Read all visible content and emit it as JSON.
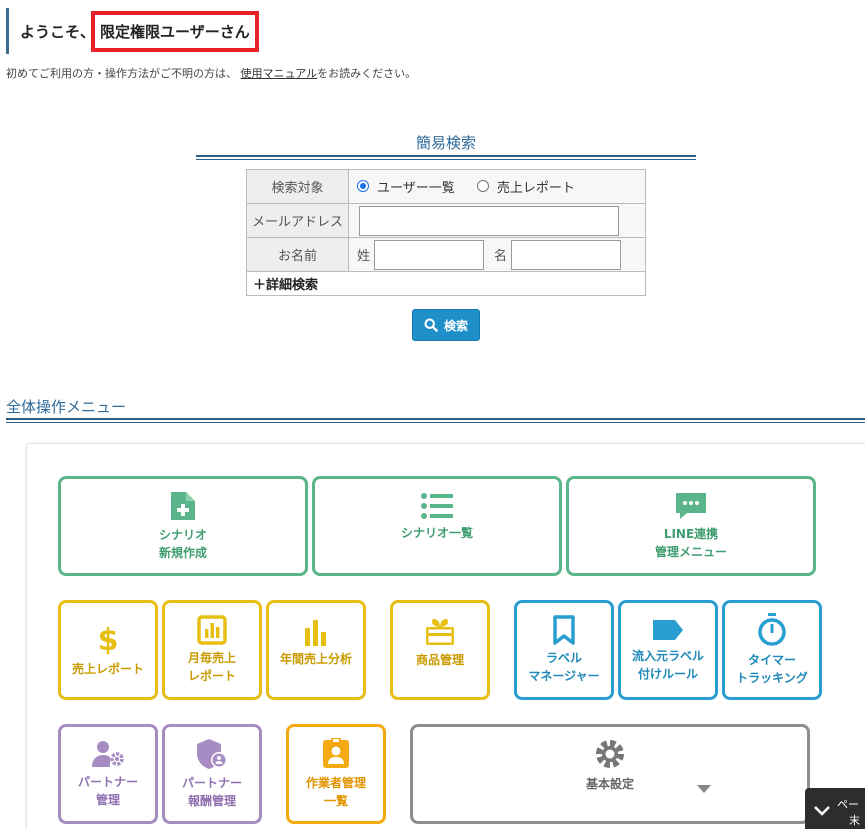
{
  "header": {
    "greeting": "ようこそ、",
    "user_name": "限定権限ユーザーさん",
    "intro_before": "初めてご利用の方・操作方法がご不明の方は、",
    "manual_link": "使用マニュアル",
    "intro_after": "をお読みください。"
  },
  "search": {
    "title": "簡易検索",
    "target_label": "検索対象",
    "target_options": [
      "ユーザー一覧",
      "売上レポート"
    ],
    "target_selected": "ユーザー一覧",
    "email_label": "メールアドレス",
    "email_value": "",
    "name_label": "お名前",
    "last_name_label": "姓",
    "last_name_value": "",
    "first_name_label": "名",
    "first_name_value": "",
    "detail_label": "＋詳細検索",
    "button_label": "検索"
  },
  "menu": {
    "title": "全体操作メニュー",
    "tiles": {
      "scenario_new": "シナリオ\n新規作成",
      "scenario_list": "シナリオ一覧",
      "line_menu": "LINE連携\n管理メニュー",
      "sales_report": "売上レポート",
      "monthly_report": "月毎売上\nレポート",
      "annual_analysis": "年間売上分析",
      "product_mgmt": "商品管理",
      "label_manager": "ラベル\nマネージャー",
      "inflow_label_rule": "流入元ラベル\n付けルール",
      "timer_tracking": "タイマー\nトラッキング",
      "partner_mgmt": "パートナー\n管理",
      "partner_reward": "パートナー\n報酬管理",
      "worker_list": "作業者管理\n一覧",
      "basic_settings": "基本設定"
    }
  },
  "page_top": {
    "line1": "ペー",
    "line2": "末"
  },
  "colors": {
    "green": "#5bb58a",
    "yellow": "#e6bf12",
    "blue": "#2a9ed0",
    "purple": "#a68cc3",
    "orange": "#f2aa10",
    "gray": "#8d8d8d",
    "highlight": "#e8202a",
    "search_button": "#1f8fca"
  },
  "icons": {
    "scenario_new": "file-plus-icon",
    "scenario_list": "list-icon",
    "line_menu": "chat-bubble-icon",
    "sales_report": "dollar-icon",
    "monthly_report": "bar-chart-square-icon",
    "annual_analysis": "bar-chart-icon",
    "product_mgmt": "gift-icon",
    "label_manager": "bookmark-icon",
    "inflow_label_rule": "tag-icon",
    "timer_tracking": "stopwatch-icon",
    "partner_mgmt": "user-cog-icon",
    "partner_reward": "shield-user-icon",
    "worker_list": "id-card-icon",
    "basic_settings": "gear-icon"
  }
}
